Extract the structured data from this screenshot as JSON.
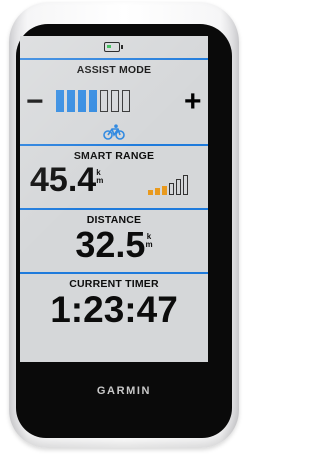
{
  "device": {
    "brand": "GARMIN"
  },
  "status": {
    "battery_icon": "battery-low-icon",
    "battery_color": "#2db84b"
  },
  "assist": {
    "label": "ASSIST MODE",
    "minus": "−",
    "plus": "+",
    "level": 4,
    "max_level": 7,
    "active_color": "#2a86e0",
    "mode_icon": "e-bike-icon"
  },
  "range": {
    "label": "SMART RANGE",
    "value": "45.4",
    "unit_top": "k",
    "unit_bottom": "m",
    "signal_level": 3,
    "signal_max": 6,
    "signal_color": "#e99a1e"
  },
  "distance": {
    "label": "DISTANCE",
    "value": "32.5",
    "unit_top": "k",
    "unit_bottom": "m"
  },
  "timer": {
    "label": "CURRENT TIMER",
    "value": "1:23:47"
  },
  "theme": {
    "divider_color": "#1f7bdc",
    "screen_bg": "#d5d7d9"
  }
}
